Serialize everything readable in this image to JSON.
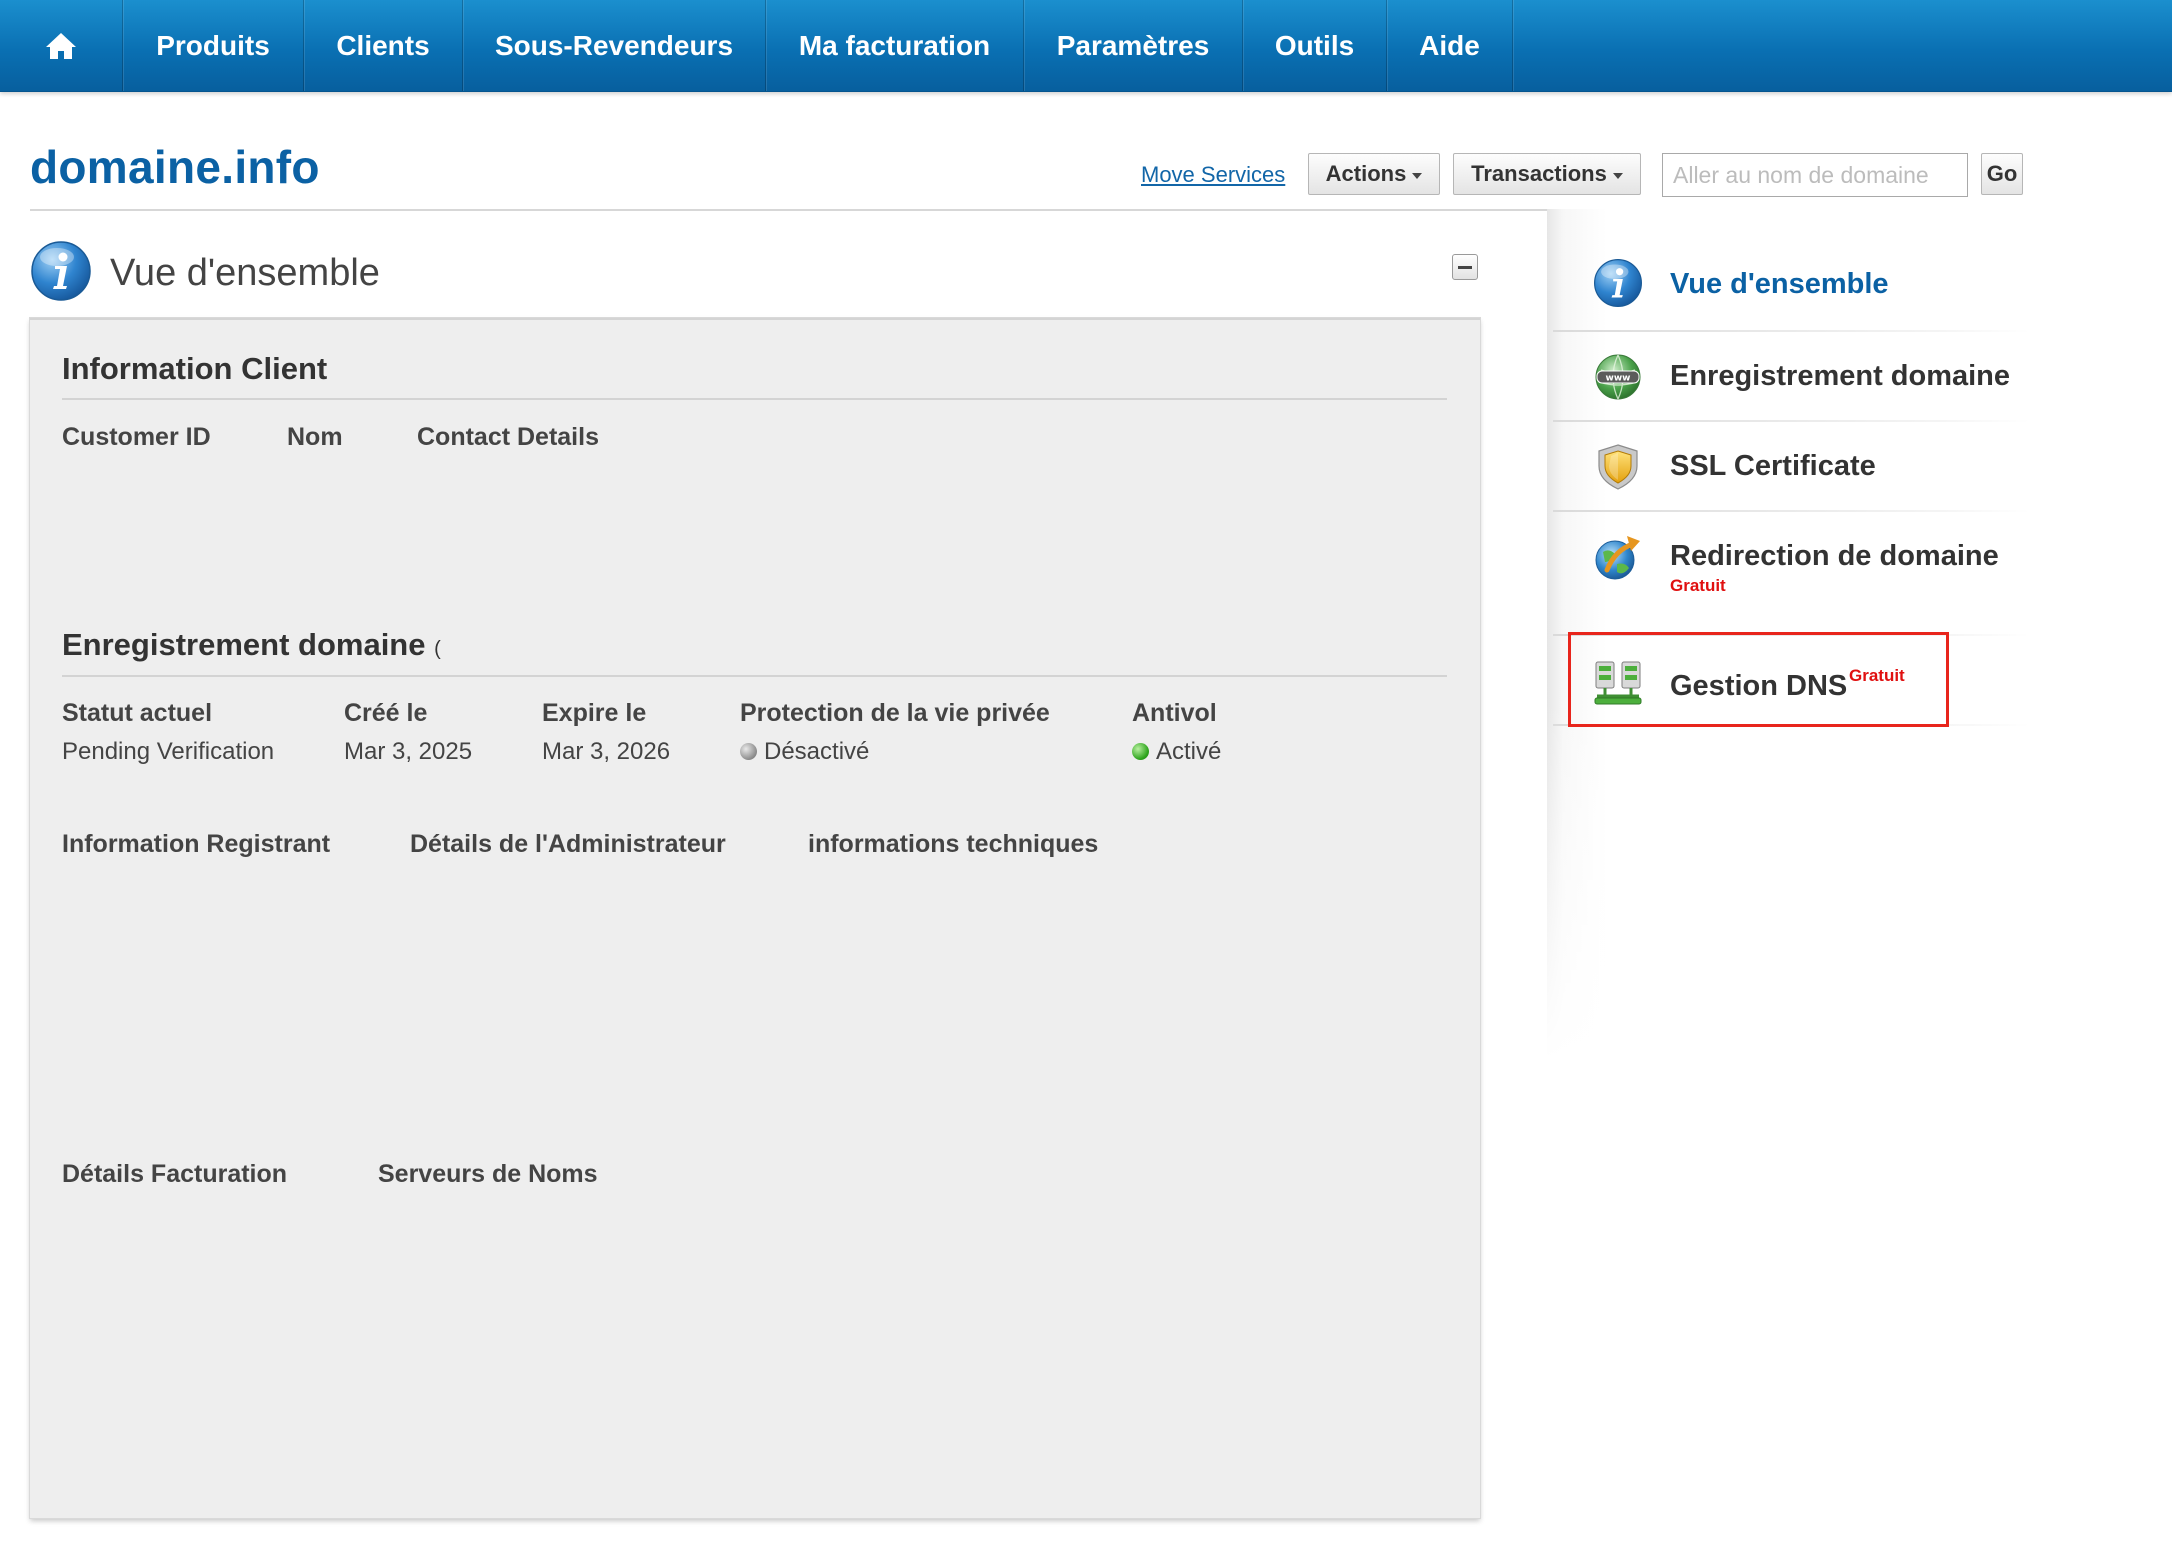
{
  "nav": {
    "home_icon": "home-icon",
    "items": [
      "Produits",
      "Clients",
      "Sous-Revendeurs",
      "Ma facturation",
      "Paramètres",
      "Outils",
      "Aide"
    ]
  },
  "header": {
    "domain": "domaine.info",
    "move_services": "Move Services",
    "actions_label": "Actions",
    "transactions_label": "Transactions",
    "search_placeholder": "Aller au nom de domaine",
    "go_label": "Go"
  },
  "overview": {
    "title": "Vue d'ensemble",
    "client_info": {
      "title": "Information Client",
      "columns": [
        "Customer ID",
        "Nom",
        "Contact Details"
      ]
    },
    "registration": {
      "title": "Enregistrement domaine",
      "title_suffix": "(",
      "columns": [
        "Statut actuel",
        "Créé le",
        "Expire le",
        "Protection de la vie privée",
        "Antivol"
      ],
      "values": {
        "status": "Pending Verification",
        "created": "Mar 3, 2025",
        "expires": "Mar 3, 2026",
        "privacy": "Désactivé",
        "theft": "Activé"
      },
      "privacy_indicator": "grey",
      "theft_indicator": "green"
    },
    "contacts": {
      "columns": [
        "Information Registrant",
        "Détails de l'Administrateur",
        "informations techniques"
      ]
    },
    "billing": {
      "columns": [
        "Détails Facturation",
        "Serveurs de Noms"
      ]
    }
  },
  "sidebar": {
    "items": [
      {
        "label": "Vue d'ensemble",
        "icon": "info-icon",
        "active": true
      },
      {
        "label": "Enregistrement domaine",
        "icon": "www-globe-icon"
      },
      {
        "label": "SSL Certificate",
        "icon": "shield-icon"
      },
      {
        "label": "Redirection de domaine",
        "icon": "globe-arrow-icon",
        "badge": "Gratuit"
      },
      {
        "label": "Gestion DNS",
        "icon": "dns-servers-icon",
        "badge": "Gratuit",
        "highlighted": true
      }
    ]
  },
  "colors": {
    "nav_blue": "#0a70b3",
    "link_blue": "#0b61a4",
    "free_red": "#e01010",
    "highlight_red": "#e8251c"
  }
}
